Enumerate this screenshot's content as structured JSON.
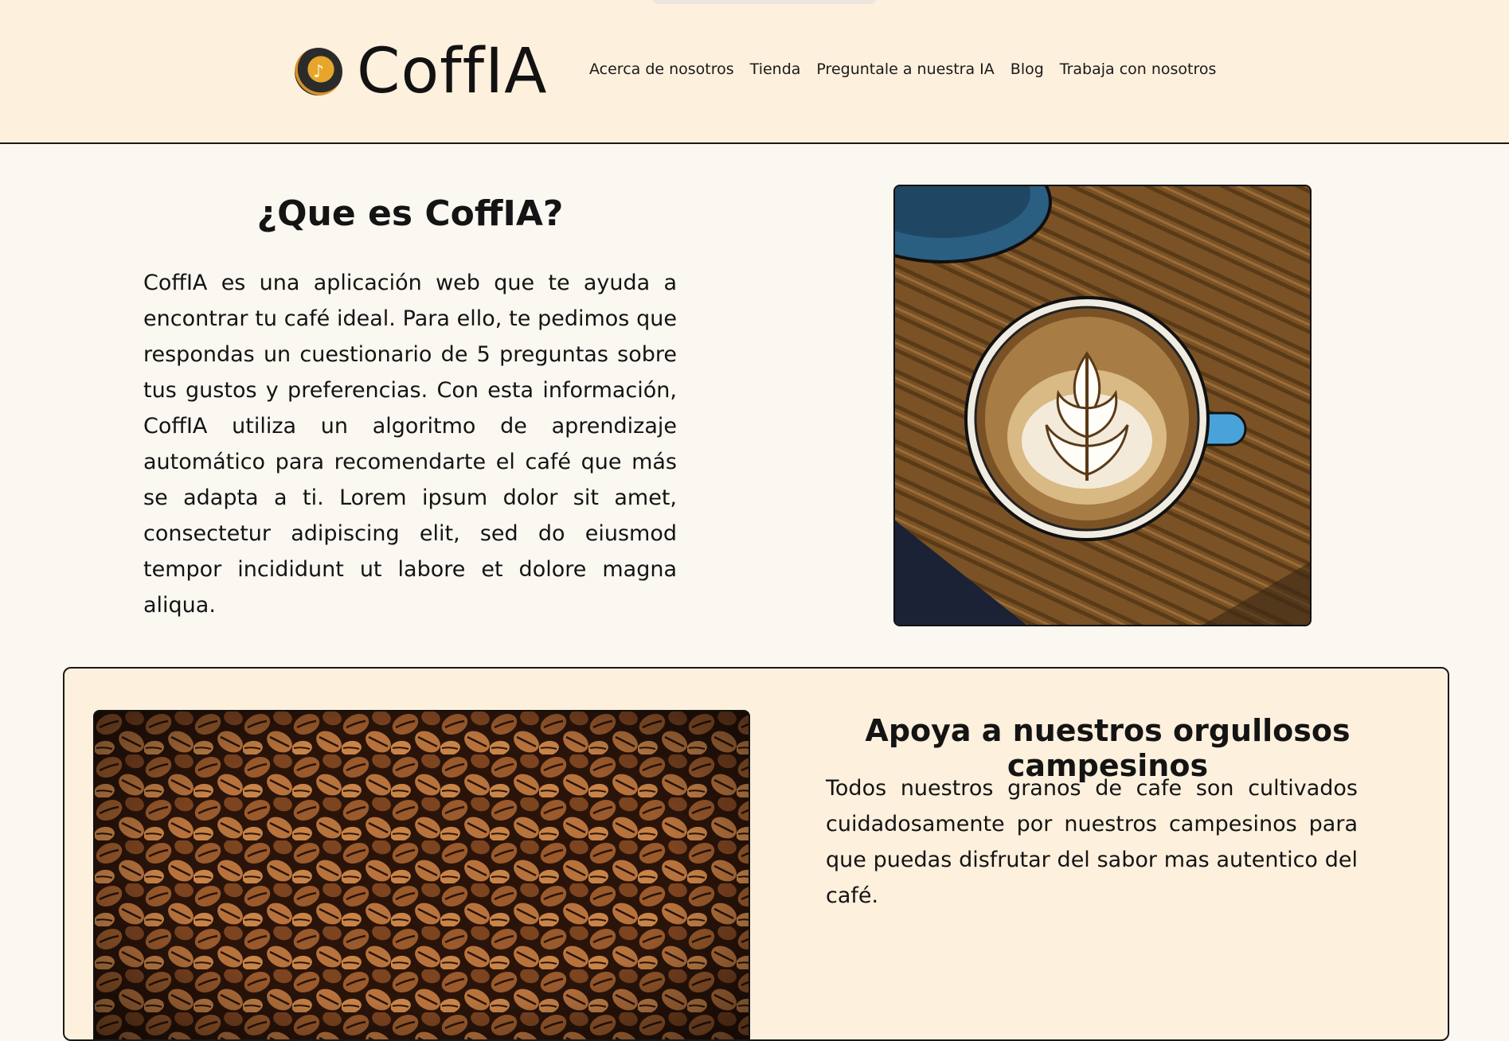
{
  "brand": {
    "name": "CoffIA",
    "logo_icon": "coffee-cup-icon"
  },
  "nav": {
    "items": [
      {
        "label": "Acerca de nosotros"
      },
      {
        "label": "Tienda"
      },
      {
        "label": "Preguntale a nuestra IA"
      },
      {
        "label": "Blog"
      },
      {
        "label": "Trabaja con nosotros"
      }
    ]
  },
  "about": {
    "title": "¿Que es CoffIA?",
    "text": "CoffIA es una aplicación web que te ayuda a encontrar tu café ideal. Para ello, te pedimos que respondas un cuestionario de 5 preguntas sobre tus gustos y preferencias. Con esta información, CoffIA utiliza un algoritmo de aprendizaje automático para recomendarte el café que más se adapta a ti. Lorem ipsum dolor sit amet, consectetur adipiscing elit, sed do eiusmod tempor incididunt ut labore et dolore magna aliqua."
  },
  "farmers": {
    "title": "Apoya a nuestros orgullosos campesinos",
    "text": "Todos nuestros granos de cafe son cultivados cuidadosamente por nuestros campesinos para que puedas disfrutar del sabor mas autentico del café."
  },
  "colors": {
    "header_bg": "#fdf0dd",
    "page_bg": "#fbf7f1",
    "card_bg": "#fdf0dd",
    "text": "#141414"
  }
}
